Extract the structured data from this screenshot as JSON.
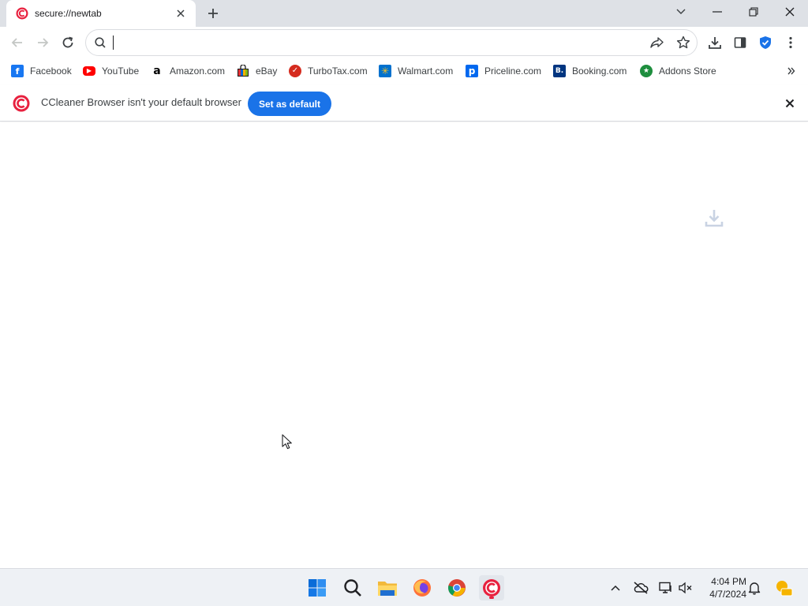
{
  "colors": {
    "accent": "#1a73e8",
    "ccleaner_red": "#e8213f",
    "tabstrip": "#dee1e6"
  },
  "tab": {
    "title": "secure://newtab",
    "favicon": "ccleaner-logo-icon"
  },
  "window_controls": [
    "chevron-down-icon",
    "minimize-icon",
    "restore-icon",
    "close-icon"
  ],
  "toolbar": {
    "omnibox_value": "",
    "omnibox_placeholder": ""
  },
  "bookmarks": [
    {
      "label": "Facebook",
      "icon": "facebook-icon",
      "glyph": "f",
      "color": "#1877f2"
    },
    {
      "label": "YouTube",
      "icon": "youtube-icon",
      "glyph": "▶",
      "color": "#ff0000"
    },
    {
      "label": "Amazon.com",
      "icon": "amazon-icon",
      "glyph": "a",
      "color": "#000000"
    },
    {
      "label": "eBay",
      "icon": "ebay-icon",
      "glyph": "",
      "color": "#e53238"
    },
    {
      "label": "TurboTax.com",
      "icon": "turbotax-icon",
      "glyph": "✓",
      "color": "#d52b1e"
    },
    {
      "label": "Walmart.com",
      "icon": "walmart-icon",
      "glyph": "✳",
      "color": "#0071ce"
    },
    {
      "label": "Priceline.com",
      "icon": "priceline-icon",
      "glyph": "p",
      "color": "#0068ef"
    },
    {
      "label": "Booking.com",
      "icon": "booking-icon",
      "glyph": "B.",
      "color": "#003580"
    },
    {
      "label": "Addons Store",
      "icon": "addons-store-icon",
      "glyph": "★",
      "color": "#1e8e3e"
    }
  ],
  "infobar": {
    "message": "CCleaner Browser isn't your default browser",
    "button_label": "Set as default"
  },
  "taskbar": {
    "apps": [
      "start-icon",
      "search-icon",
      "file-explorer-icon",
      "firefox-icon",
      "chrome-icon",
      "ccleaner-browser-icon"
    ],
    "time": "4:04 PM",
    "date": "4/7/2024"
  }
}
